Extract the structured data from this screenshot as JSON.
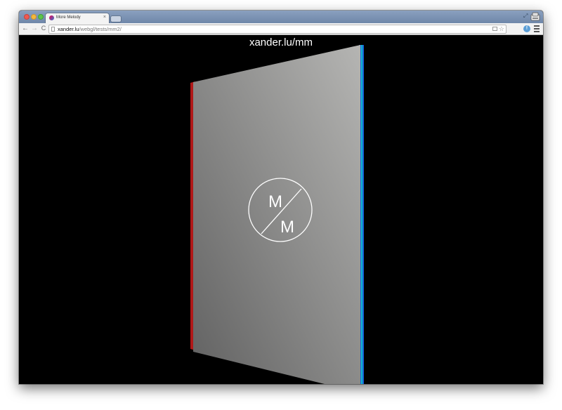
{
  "browser": {
    "tab": {
      "title": "More Melody",
      "close": "×"
    },
    "toolbar": {
      "back": "←",
      "forward": "→",
      "reload": "C"
    },
    "address": {
      "host": "xander.lu",
      "path": "/webgl/tests/mm2/"
    },
    "extension_label": "f"
  },
  "page": {
    "title": "xander.lu/mm",
    "logo": {
      "top_letter": "M",
      "bottom_letter": "M"
    },
    "colors": {
      "background": "#000000",
      "panel_dark": "#616161",
      "panel_light": "#b5b5b3",
      "edge_red": "#b01818",
      "edge_blue": "#1560d8",
      "edge_cyan": "#16b8cc"
    }
  },
  "icons": {
    "tab_favicon": "more-melody-favicon",
    "fullscreen": "fullscreen-arrows-icon",
    "user": "user-profile-icon",
    "page": "page-icon",
    "camera": "camera-icon",
    "bookmark": "star-icon",
    "menu": "hamburger-menu-icon"
  }
}
